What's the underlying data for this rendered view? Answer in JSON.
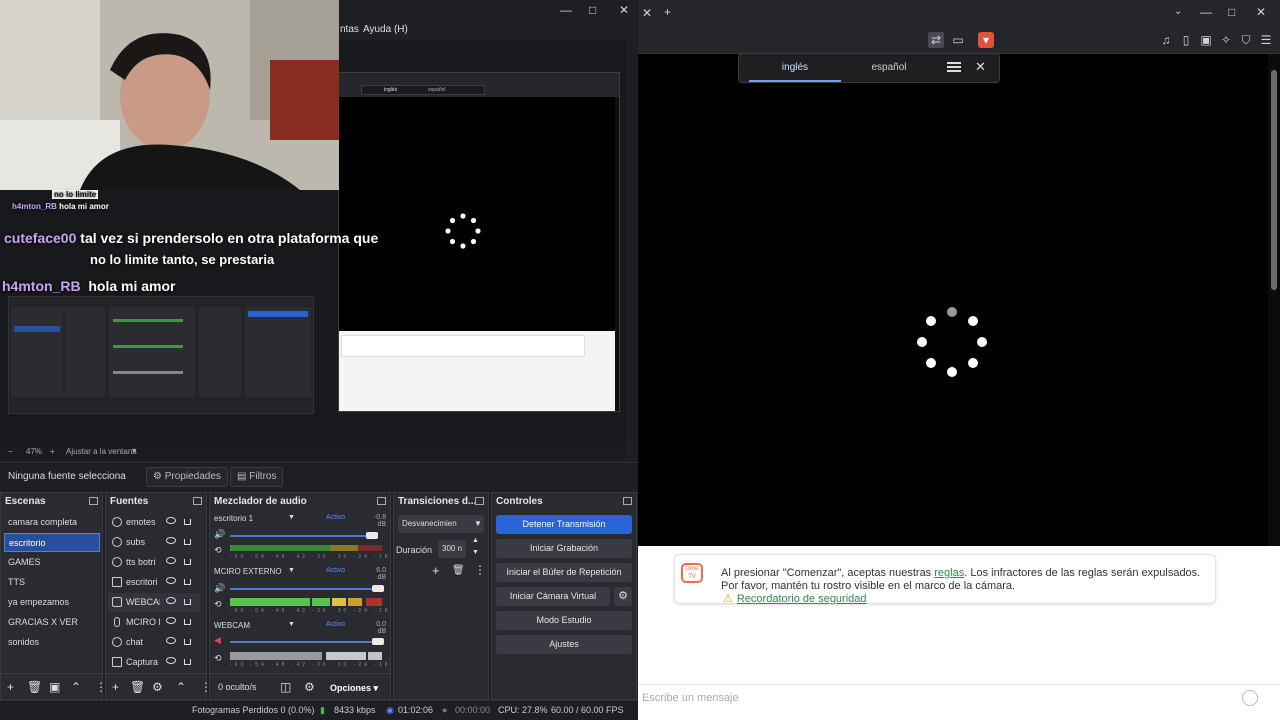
{
  "browser": {
    "translate_tabs": [
      "inglés",
      "español"
    ],
    "notice": {
      "text_before": "Al presionar \"Comenzar\", aceptas nuestras ",
      "link": "reglas",
      "text_after": ". Los infractores de las reglas serán expulsados. Por favor, mantén tu rostro visible en el marco de la cámara.",
      "safety_link": "Recordatorio de seguridad"
    },
    "message_placeholder": "Escribe un mensaje"
  },
  "obs": {
    "menu_partial": "ntas",
    "menu_help": "Ayuda (H)",
    "preview": {
      "chat": [
        {
          "user": "no lo limite",
          "msg": ""
        },
        {
          "user": "h4mton_RB",
          "msg": "hola mi amor"
        },
        {
          "user": "cuteface00",
          "msg": "tal vez si prendersolo en otra plataforma que"
        },
        {
          "user": "",
          "msg": "no lo limite tanto, se prestaria"
        },
        {
          "user": "h4mton_RB",
          "msg": "hola mi amor"
        }
      ],
      "nested_tabs": [
        "inglés",
        "español"
      ]
    },
    "zoom": {
      "percent": "47%",
      "fit": "Ajustar a la ventana"
    },
    "source_bar": {
      "none_selected": "Ninguna fuente selecciona",
      "properties": "Propiedades",
      "filters": "Filtros"
    },
    "scenes": {
      "title": "Escenas",
      "items": [
        "camara completa",
        "escritorio",
        "GAMES",
        "TTS",
        "ya empezamos",
        "GRACIAS X VER",
        "sonidos"
      ],
      "selected": "escritorio"
    },
    "sources": {
      "title": "Fuentes",
      "items": [
        "emotes",
        "subs",
        "tts botri",
        "escritori",
        "WEBCAM",
        "MCIRO E",
        "chat",
        "Captura"
      ]
    },
    "mixer": {
      "title": "Mezclador de audio",
      "channels": [
        {
          "name": "escritorio 1",
          "status": "Activo",
          "db": "-0.8 dB"
        },
        {
          "name": "MCIRO EXTERNO",
          "status": "Activo",
          "db": "6.0 dB"
        },
        {
          "name": "WEBCAM",
          "status": "Activo",
          "db": "0.0 dB"
        }
      ],
      "ticks": "-60 -54 -48 -42 -36 -30 -24 -18 -12 -6 0",
      "hidden": "0 oculto/s",
      "options": "Opciones"
    },
    "transitions": {
      "title": "Transiciones d...",
      "selected": "Desvanecimien",
      "duration_label": "Duración",
      "duration_value": "300 n"
    },
    "controls": {
      "title": "Controles",
      "buttons": [
        "Detener Transmisión",
        "Iniciar Grabación",
        "Iniciar el Búfer de Repetición",
        "Iniciar Cámara Virtual",
        "Modo Estudio",
        "Ajustes"
      ]
    },
    "status": {
      "dropped": "Fotogramas Perdidos 0 (0.0%)",
      "bitrate": "8433 kbps",
      "live_time": "01:02:06",
      "rec_time": "00:00:00",
      "cpu": "CPU: 27.8%",
      "fps": "60.00 / 60.00 FPS"
    }
  }
}
